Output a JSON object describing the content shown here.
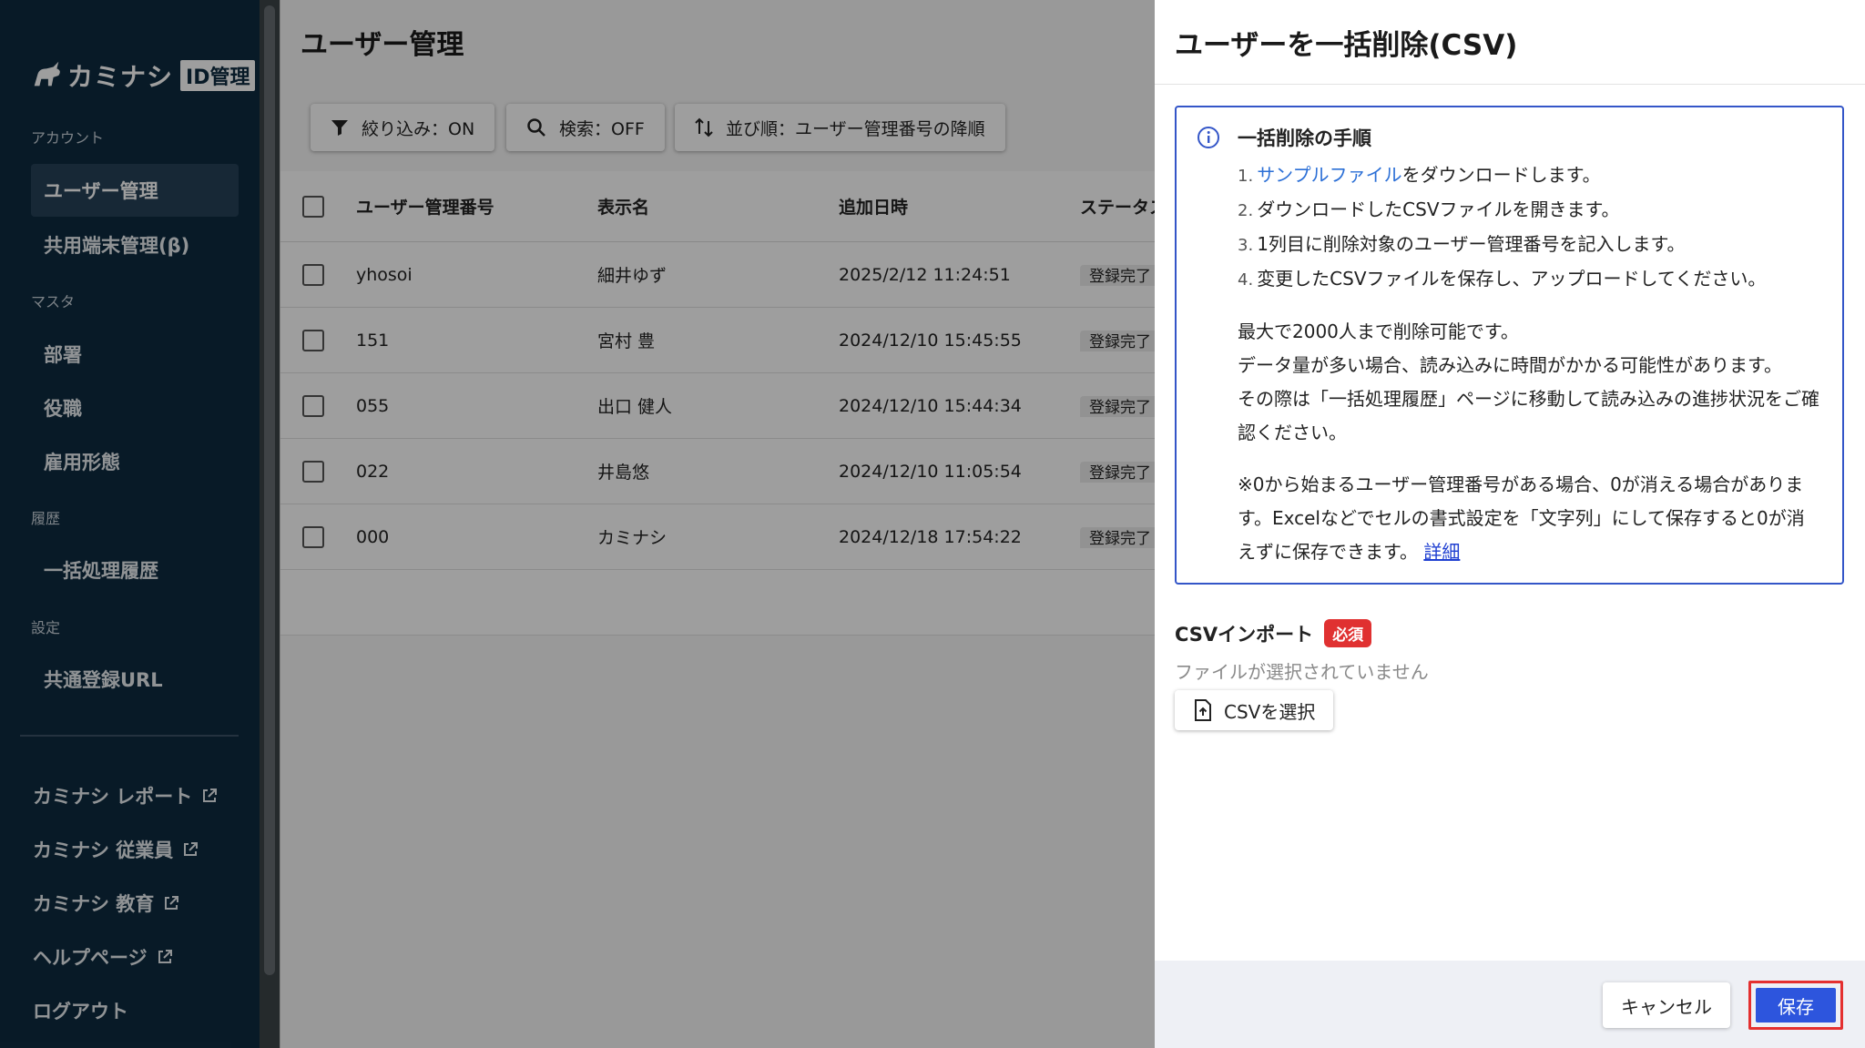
{
  "sidebar": {
    "logo_text": "カミナシ",
    "logo_badge": "ID管理",
    "sections": {
      "account": "アカウント",
      "master": "マスタ",
      "history": "履歴",
      "settings": "設定"
    },
    "items": {
      "user_mgmt": "ユーザー管理",
      "shared_device": "共用端末管理(β)",
      "department": "部署",
      "position": "役職",
      "employment_type": "雇用形態",
      "batch_history": "一括処理履歴",
      "common_url": "共通登録URL"
    },
    "external_links": [
      "カミナシ レポート",
      "カミナシ 従業員",
      "カミナシ 教育",
      "ヘルプページ"
    ],
    "logout": "ログアウト"
  },
  "main": {
    "title": "ユーザー管理",
    "toolbar": {
      "filter": "絞り込み：ON",
      "search": "検索：OFF",
      "sort": "並び順：ユーザー管理番号の降順"
    },
    "table": {
      "headers": [
        "ユーザー管理番号",
        "表示名",
        "追加日時",
        "ステータス"
      ],
      "rows": [
        {
          "id": "yhosoi",
          "name": "細井ゆず",
          "added": "2025/2/12 11:24:51",
          "status": "登録完了"
        },
        {
          "id": "151",
          "name": "宮村 豊",
          "added": "2024/12/10 15:45:55",
          "status": "登録完了"
        },
        {
          "id": "055",
          "name": "出口 健人",
          "added": "2024/12/10 15:44:34",
          "status": "登録完了"
        },
        {
          "id": "022",
          "name": "井島悠",
          "added": "2024/12/10 11:05:54",
          "status": "登録完了"
        },
        {
          "id": "000",
          "name": "カミナシ",
          "added": "2024/12/18 17:54:22",
          "status": "登録完了"
        }
      ]
    }
  },
  "drawer": {
    "title": "ユーザーを一括削除(CSV)",
    "info": {
      "title": "一括削除の手順",
      "step1_link": "サンプルファイル",
      "step1_rest": "をダウンロードします。",
      "step2": "ダウンロードしたCSVファイルを開きます。",
      "step3": "1列目に削除対象のユーザー管理番号を記入します。",
      "step4": "変更したCSVファイルを保存し、アップロードしてください。",
      "note_line1": "最大で2000人まで削除可能です。",
      "note_line2": "データ量が多い場合、読み込みに時間がかかる可能性があります。",
      "note_line3": "その際は「一括処理履歴」ページに移動して読み込みの進捗状況をご確認ください。",
      "note2_text": "※0から始まるユーザー管理番号がある場合、0が消える場合があります。Excelなどでセルの書式設定を「文字列」にして保存すると0が消えずに保存できます。",
      "note2_link": "詳細"
    },
    "csv_label": "CSVインポート",
    "required_badge": "必須",
    "no_file": "ファイルが選択されていません",
    "select_button": "CSVを選択",
    "cancel_button": "キャンセル",
    "save_button": "保存"
  },
  "colors": {
    "sidebar_bg": "#0e2b40",
    "accent_blue": "#2d55dd",
    "required_red": "#e03131",
    "info_border": "#3456c8"
  }
}
